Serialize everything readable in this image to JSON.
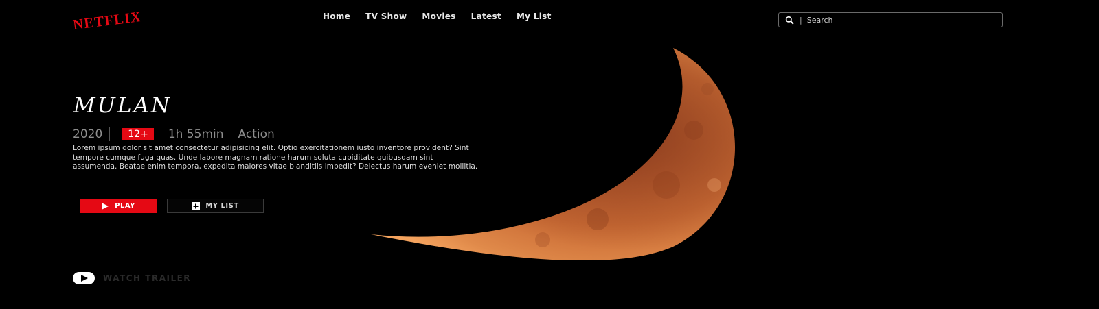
{
  "brand": {
    "logo": "NETFLIX",
    "accent": "#e50914"
  },
  "nav": {
    "items": [
      {
        "label": "Home"
      },
      {
        "label": "TV Show"
      },
      {
        "label": "Movies"
      },
      {
        "label": "Latest"
      },
      {
        "label": "My List"
      }
    ]
  },
  "search": {
    "placeholder": "Search",
    "icon": "search-icon"
  },
  "hero": {
    "title": "MULAN",
    "year": "2020",
    "rating": "12+",
    "duration": "1h 55min",
    "genre": "Action",
    "description": "Lorem ipsum dolor sit amet consectetur adipisicing elit. Optio exercitationem iusto inventore provident? Sint tempore cumque fuga quas. Unde labore magnam ratione harum soluta cupiditate quibusdam sint assumenda. Beatae enim tempora, expedita maiores vitae blanditiis impedit? Delectus harum eveniet mollitia.",
    "play_label": "PLAY",
    "mylist_label": "MY LIST",
    "trailer_label": "WATCH TRAILER"
  }
}
